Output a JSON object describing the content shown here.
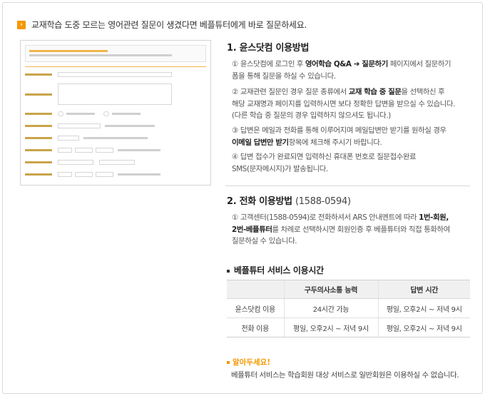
{
  "header": {
    "bullet_icon": "arrow-right-icon",
    "text": "교재학습 도중 모르는 영어관련 질문이 생겼다면 베플튜터에게 바로 질문하세요."
  },
  "section1": {
    "title": "1. 윤스닷컴 이용방법",
    "p1": [
      "① 윤스닷컴에 로그인 후 ",
      "영어학습 Q&A ➔ 질문하기",
      " 페이지에서 질문하기",
      "폼을 통해 질문을 하실 수 있습니다."
    ],
    "p2": [
      "② 교재관련 질문인 경우 질문 종류에서 ",
      "교재 학습 중 질문",
      "을 선택하신 후",
      "해당 교재명과 페이지를 입력하시면 보다 정확한 답변을 받으실 수 있습니다.",
      "(다른 학습 중 질문의 경우 입력하지 않으셔도 됩니다.)"
    ],
    "p3": [
      "③ 답변은 메일과 전화를 통해 이루어지며 메일답변만 받기를 원하실 경우",
      "이메일 답변만 받기",
      "항목에 체크해 주시기 바랍니다."
    ],
    "p4": [
      "④ 답변 접수가 완료되면 입력하신 휴대폰 번호로 질문접수완료",
      "SMS(문자메시지)가 발송됩니다."
    ]
  },
  "section2": {
    "title": "2. 전화 이용방법 ",
    "title_phone": "(1588-0594)",
    "p1": [
      "① 고객센터(1588-0594)로 전화하셔서 ARS 안내멘트에 따라 ",
      "1번-회원,",
      "2번-베플튜터",
      "를 차례로 선택하시면 회원인증 후 베플튜터와 직접 통화하여",
      "질문하실 수 있습니다."
    ]
  },
  "service": {
    "title": "베플튜터 서비스 이용시간",
    "headers": [
      "",
      "구두의사소통 능력",
      "답변 시간"
    ],
    "rows": [
      [
        "윤스닷컴 이용",
        "24시간 가능",
        "평일, 오후2시 ~ 저녁 9시"
      ],
      [
        "전화 이용",
        "평일, 오후2시 ~ 저녁 9시",
        "평일, 오후2시 ~ 저녁 9시"
      ]
    ]
  },
  "notice": {
    "title": "알아두세요!",
    "text": "베플튜터 서비스는 학습회원 대상 서비스로 일반회원은 이용하실 수 없습니다."
  },
  "colors": {
    "accent": "#f39800"
  }
}
